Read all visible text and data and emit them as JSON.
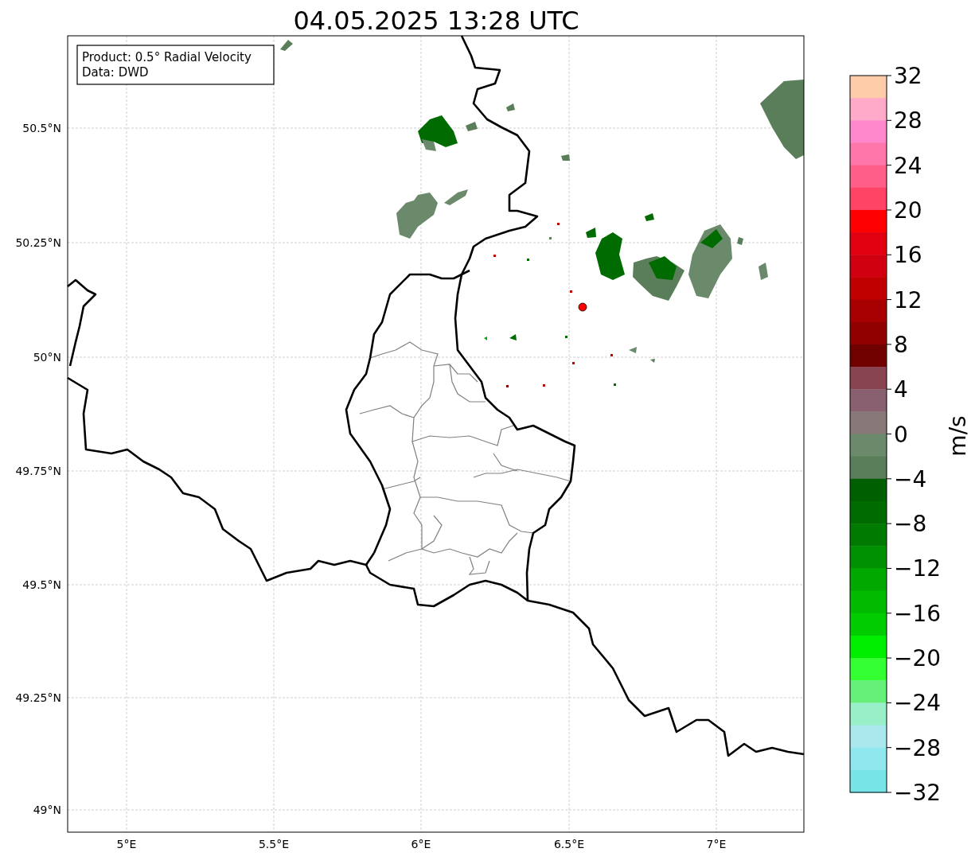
{
  "title": "04.05.2025 13:28 UTC",
  "info_box": [
    "Product: 0.5° Radial Velocity",
    "Data: DWD"
  ],
  "map": {
    "xticks": [
      "5°E",
      "5.5°E",
      "6°E",
      "6.5°E",
      "7°E"
    ],
    "yticks": [
      "50.5°N",
      "50.25°N",
      "50°N",
      "49.75°N",
      "49.5°N",
      "49.25°N",
      "49°N"
    ]
  },
  "colorbar": {
    "label": "m/s",
    "ticks": [
      "32",
      "28",
      "24",
      "20",
      "16",
      "12",
      "8",
      "4",
      "0",
      "−4",
      "−8",
      "−12",
      "−16",
      "−20",
      "−24",
      "−28",
      "−32"
    ],
    "bands": [
      {
        "color": "#ffccaa"
      },
      {
        "color": "#ffaac8"
      },
      {
        "color": "#ff88cc"
      },
      {
        "color": "#ff77aa"
      },
      {
        "color": "#ff5f88"
      },
      {
        "color": "#ff4466"
      },
      {
        "color": "#ff0000"
      },
      {
        "color": "#e00010"
      },
      {
        "color": "#d00010"
      },
      {
        "color": "#c00000"
      },
      {
        "color": "#a80000"
      },
      {
        "color": "#900000"
      },
      {
        "color": "#700000"
      },
      {
        "color": "#884450"
      },
      {
        "color": "#886070"
      },
      {
        "color": "#887878"
      },
      {
        "color": "#6b8a6b"
      },
      {
        "color": "#5a7d5a"
      },
      {
        "color": "#005f00"
      },
      {
        "color": "#006b00"
      },
      {
        "color": "#007a00"
      },
      {
        "color": "#009100"
      },
      {
        "color": "#00a800"
      },
      {
        "color": "#00bb00"
      },
      {
        "color": "#00cc00"
      },
      {
        "color": "#00ee00"
      },
      {
        "color": "#33ff33"
      },
      {
        "color": "#66f07a"
      },
      {
        "color": "#99f0c8"
      },
      {
        "color": "#aae8ee"
      },
      {
        "color": "#90e8ee"
      },
      {
        "color": "#77e4e8"
      }
    ]
  }
}
